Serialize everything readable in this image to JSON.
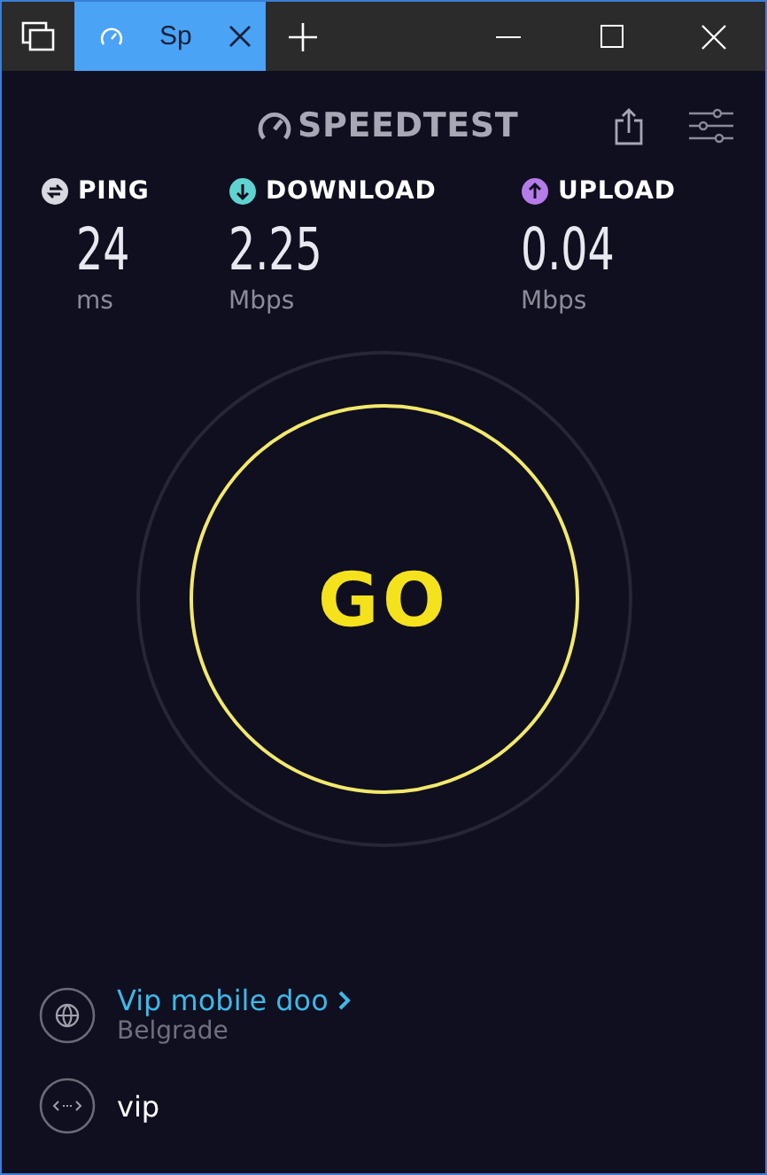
{
  "tabs": [
    {
      "title": "Sp",
      "selected": true
    }
  ],
  "app": {
    "logo": "SPEEDTEST"
  },
  "metrics": [
    {
      "kind": "ping",
      "label": "PING",
      "value": "24",
      "unit": "ms",
      "color": "#d8d8e0"
    },
    {
      "kind": "download",
      "label": "DOWNLOAD",
      "value": "2.25",
      "unit": "Mbps",
      "color": "#5fd3cf"
    },
    {
      "kind": "upload",
      "label": "UPLOAD",
      "value": "0.04",
      "unit": "Mbps",
      "color": "#b57be8"
    }
  ],
  "go_button": {
    "label": "GO"
  },
  "server": {
    "provider": "Vip mobile doo",
    "location": "Belgrade"
  },
  "connection": {
    "name": "vip"
  }
}
